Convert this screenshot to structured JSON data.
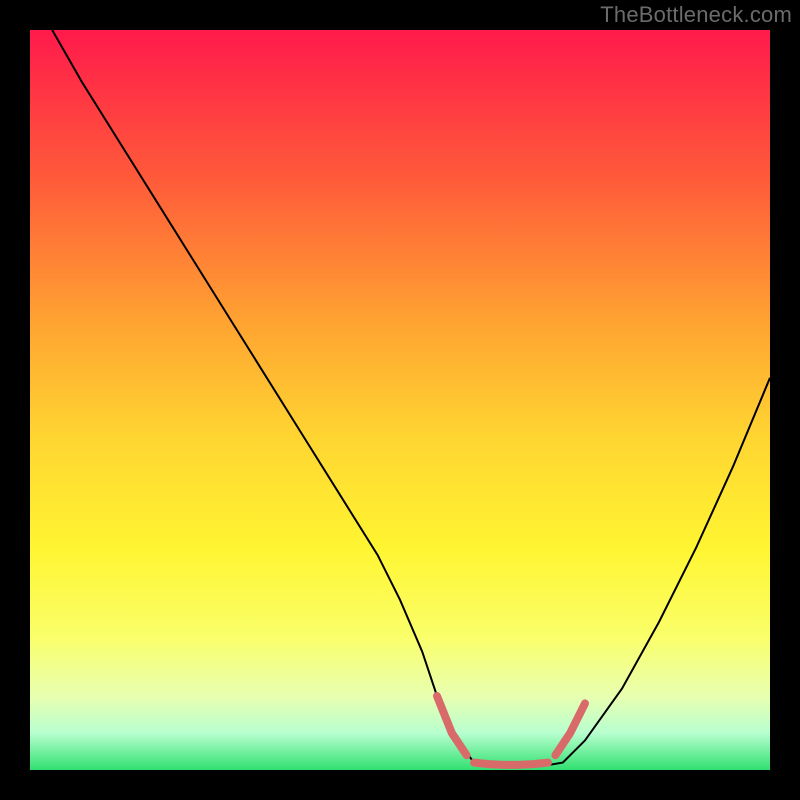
{
  "watermark": "TheBottleneck.com",
  "chart_data": {
    "type": "line",
    "title": "",
    "xlabel": "",
    "ylabel": "",
    "xlim": [
      0,
      100
    ],
    "ylim": [
      0,
      100
    ],
    "grid": false,
    "gradient_stops": [
      {
        "offset": 0.0,
        "color": "#ff1a4b"
      },
      {
        "offset": 0.2,
        "color": "#ff5a3a"
      },
      {
        "offset": 0.4,
        "color": "#ffa531"
      },
      {
        "offset": 0.55,
        "color": "#ffd531"
      },
      {
        "offset": 0.7,
        "color": "#fff531"
      },
      {
        "offset": 0.82,
        "color": "#faff6a"
      },
      {
        "offset": 0.9,
        "color": "#e8ffb0"
      },
      {
        "offset": 0.95,
        "color": "#b8ffcf"
      },
      {
        "offset": 1.0,
        "color": "#30e070"
      }
    ],
    "series": [
      {
        "name": "bottleneck-curve",
        "stroke": "#000000",
        "stroke_width": 2,
        "x": [
          3,
          7,
          12,
          17,
          22,
          27,
          32,
          37,
          42,
          47,
          50,
          53,
          55,
          57,
          60,
          63,
          66,
          69,
          72,
          75,
          80,
          85,
          90,
          95,
          100
        ],
        "y": [
          100,
          93,
          85,
          77,
          69,
          61,
          53,
          45,
          37,
          29,
          23,
          16,
          10,
          5,
          1,
          0.5,
          0.5,
          0.5,
          1,
          4,
          11,
          20,
          30,
          41,
          53
        ]
      },
      {
        "name": "highlight-band",
        "stroke": "#d96a6a",
        "stroke_width": 8,
        "linecap": "round",
        "segments": [
          {
            "x": [
              55,
              57,
              59
            ],
            "y": [
              10,
              5,
              2
            ]
          },
          {
            "x": [
              60,
              62,
              64,
              66,
              68,
              70
            ],
            "y": [
              1,
              0.8,
              0.7,
              0.7,
              0.8,
              1
            ]
          },
          {
            "x": [
              71,
              73,
              75
            ],
            "y": [
              2,
              5,
              9
            ]
          }
        ]
      }
    ]
  }
}
